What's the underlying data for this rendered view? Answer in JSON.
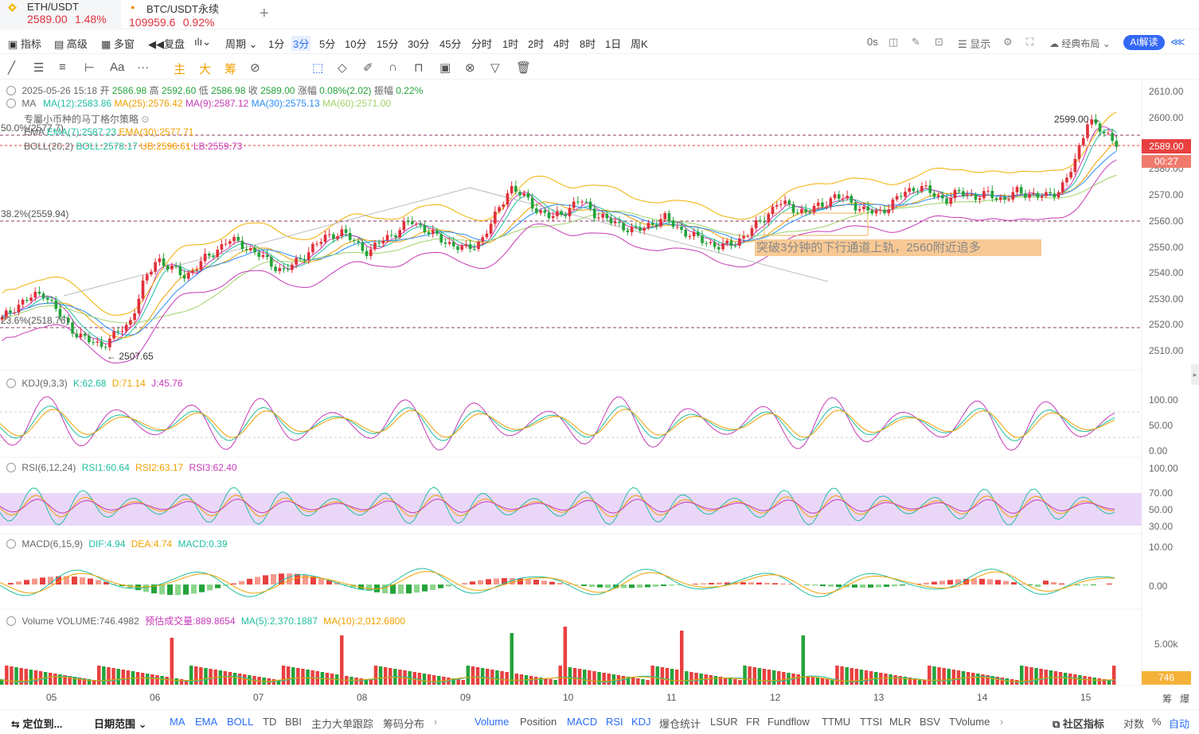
{
  "tabs": [
    {
      "symbol": "ETH/USDT",
      "price": "2589.00",
      "change": "1.48%"
    },
    {
      "symbol": "BTC/USDT永续",
      "price": "109959.6",
      "change": "0.92%"
    }
  ],
  "toolbar": {
    "items": [
      "指标",
      "高级",
      "多窗",
      "复盘",
      "周期",
      "1分",
      "3分",
      "5分",
      "10分",
      "15分",
      "30分",
      "45分",
      "分时",
      "1时",
      "2时",
      "4时",
      "8时",
      "1日",
      "周K"
    ],
    "selected": "3分",
    "right": [
      "0s",
      "显示",
      "经典布局"
    ],
    "ai_label": "AI解读",
    "colors": {
      "accent": "#2a6df4",
      "up": "#e0303a",
      "down": "#24a33a"
    }
  },
  "drawing_tools": {
    "text_tool": "Aa",
    "labels": [
      "主",
      "大",
      "筹"
    ]
  },
  "price_panel": {
    "ohlc": {
      "date": "2025-05-26 15:18",
      "open_label": "开",
      "open": "2586.98",
      "high_label": "高",
      "high": "2592.60",
      "low_label": "低",
      "low": "2586.98",
      "close_label": "收",
      "close": "2589.00",
      "chg_label": "涨幅",
      "chg": "0.08%(2.02)",
      "amp_label": "振幅",
      "amp": "0.22%"
    },
    "ma": {
      "name": "MA",
      "ma12": "MA(12):2583.86",
      "ma25": "MA(25):2576.42",
      "ma9": "MA(9):2587.12",
      "ma30": "MA(30):2575.13",
      "ma60": "MA(60):2571.00"
    },
    "strategy": "专屬小币种的马丁格尔策略",
    "ema": {
      "name": "EMA",
      "ema7": "EMA(7):2587.23",
      "ema30": "EMA(30):2577.71"
    },
    "boll": {
      "name": "BOLL(20,2)",
      "boll": "BOLL:2578.17",
      "ub": "UB:2596.61",
      "lb": "LB:2559.73"
    },
    "fib": {
      "f50": "50.0%(2577.7)",
      "f382": "38.2%(2559.94)",
      "f236": "23.6%(2518.76)"
    },
    "annotation": "突破3分钟的下行通道上轨，2560附近追多",
    "high_mark": "2599.00",
    "low_mark": "2507.65",
    "current_price": "2589.00",
    "countdown": "00:27",
    "y_ticks": [
      "2610.00",
      "2600.00",
      "2590.00",
      "2580.00",
      "2570.00",
      "2560.00",
      "2550.00",
      "2540.00",
      "2530.00",
      "2520.00",
      "2510.00"
    ]
  },
  "kdj_panel": {
    "name": "KDJ(9,3,3)",
    "k": "K:62.68",
    "d": "D:71.14",
    "j": "J:45.76",
    "y_ticks": [
      "100.00",
      "50.00",
      "0.00"
    ]
  },
  "rsi_panel": {
    "name": "RSI(6,12,24)",
    "rsi1": "RSI1:60.64",
    "rsi2": "RSI2:63.17",
    "rsi3": "RSI3:62.40",
    "y_ticks": [
      "100.00",
      "70.00",
      "50.00",
      "30.00"
    ]
  },
  "macd_panel": {
    "name": "MACD(6,15,9)",
    "dif": "DIF:4.94",
    "dea": "DEA:4.74",
    "macd": "MACD:0.39",
    "y_ticks": [
      "10.00",
      "0.00"
    ]
  },
  "volume_panel": {
    "name": "Volume",
    "volume": "VOLUME:746.4982",
    "est": "预估成交量:889.8654",
    "ma5": "MA(5):2,370.1887",
    "ma10": "MA(10):2,012.6800",
    "y_ticks": [
      "5.00k"
    ],
    "current": "746"
  },
  "x_axis": {
    "labels": [
      "05",
      "06",
      "07",
      "08",
      "09",
      "10",
      "11",
      "12",
      "13",
      "14",
      "15"
    ],
    "right": [
      "筹",
      "爆"
    ]
  },
  "bottom_bar": {
    "locate": "定位到...",
    "range": "日期范围",
    "indicators_main": [
      "MA",
      "EMA",
      "BOLL",
      "TD",
      "BBI",
      "主力大单跟踪",
      "筹码分布"
    ],
    "indicators_sub": [
      "Volume",
      "Position",
      "MACD",
      "RSI",
      "KDJ",
      "爆仓统计",
      "LSUR",
      "FR",
      "Fundflow",
      "TTMU",
      "TTSI",
      "MLR",
      "BSV",
      "TVolume"
    ],
    "community": "社区指标",
    "right": [
      "对数",
      "%",
      "自动"
    ]
  },
  "chart_data": {
    "type": "candlestick",
    "title": "ETH/USDT 3分",
    "x_labels": [
      "05",
      "06",
      "07",
      "08",
      "09",
      "10",
      "11",
      "12",
      "13",
      "14",
      "15"
    ],
    "ylim": [
      2505,
      2612
    ],
    "close_path": [
      2522,
      2527,
      2530,
      2532,
      2524,
      2518,
      2514,
      2512,
      2516,
      2520,
      2535,
      2545,
      2541,
      2538,
      2543,
      2547,
      2552,
      2550,
      2547,
      2543,
      2540,
      2544,
      2549,
      2553,
      2555,
      2551,
      2547,
      2552,
      2555,
      2559,
      2556,
      2552,
      2550,
      2548,
      2552,
      2561,
      2572,
      2568,
      2563,
      2560,
      2563,
      2567,
      2562,
      2559,
      2557,
      2555,
      2558,
      2560,
      2556,
      2553,
      2551,
      2549,
      2551,
      2555,
      2560,
      2566,
      2564,
      2562,
      2565,
      2568,
      2567,
      2563,
      2562,
      2565,
      2570,
      2572,
      2569,
      2567,
      2570,
      2568,
      2569,
      2567,
      2570,
      2569,
      2568,
      2571,
      2580,
      2598,
      2592,
      2589
    ],
    "last": {
      "open": 2586.98,
      "high": 2592.6,
      "low": 2586.98,
      "close": 2589.0
    }
  }
}
